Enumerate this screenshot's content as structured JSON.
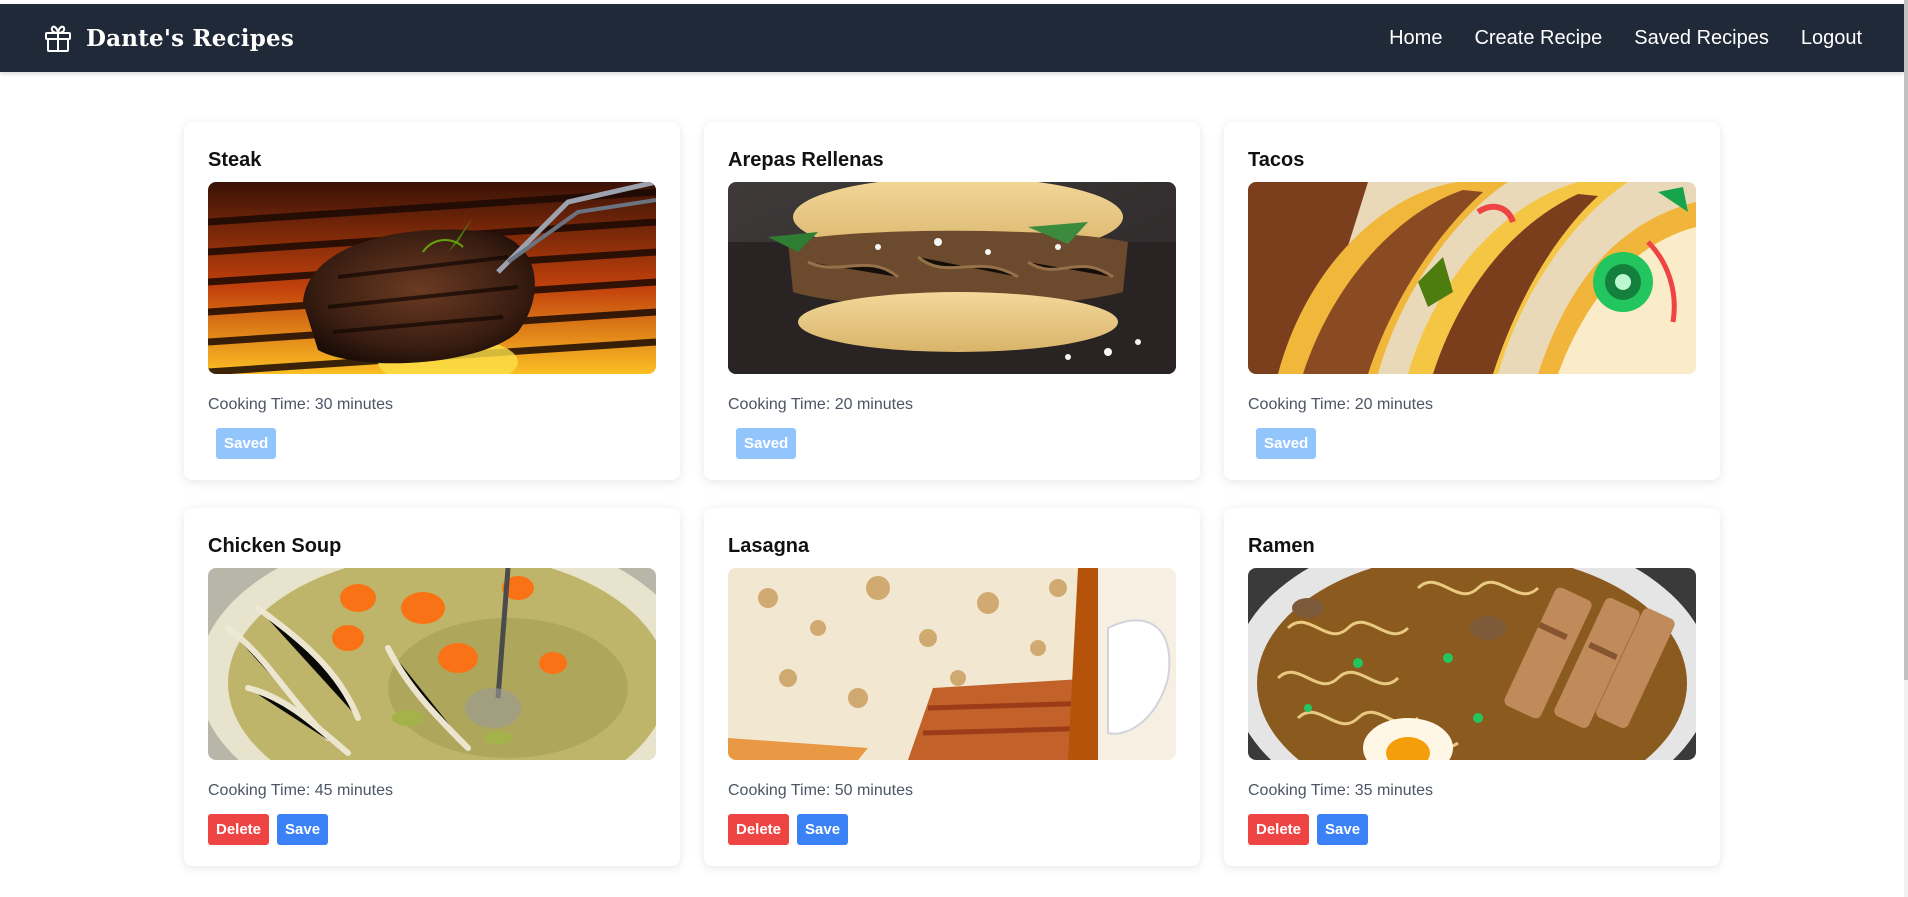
{
  "brand": {
    "title": "Dante's Recipes",
    "icon": "gift-icon"
  },
  "nav": {
    "home": "Home",
    "create": "Create Recipe",
    "saved": "Saved Recipes",
    "logout": "Logout"
  },
  "cook_prefix": "Cooking Time:",
  "recipes": [
    {
      "name": "Steak",
      "cooking_time": "Cooking Time: 30 minutes",
      "image": "steak-photo",
      "saved": true,
      "saved_label": "Saved"
    },
    {
      "name": "Arepas Rellenas",
      "cooking_time": "Cooking Time: 20 minutes",
      "image": "arepas-photo",
      "saved": true,
      "saved_label": "Saved"
    },
    {
      "name": "Tacos",
      "cooking_time": "Cooking Time: 20 minutes",
      "image": "tacos-photo",
      "saved": true,
      "saved_label": "Saved"
    },
    {
      "name": "Chicken Soup",
      "cooking_time": "Cooking Time: 45 minutes",
      "image": "chicken-soup-photo",
      "saved": false,
      "delete_label": "Delete",
      "save_label": "Save"
    },
    {
      "name": "Lasagna",
      "cooking_time": "Cooking Time: 50 minutes",
      "image": "lasagna-photo",
      "saved": false,
      "delete_label": "Delete",
      "save_label": "Save"
    },
    {
      "name": "Ramen",
      "cooking_time": "Cooking Time: 35 minutes",
      "image": "ramen-photo",
      "saved": false,
      "delete_label": "Delete",
      "save_label": "Save"
    }
  ],
  "colors": {
    "navbar": "#1f2937",
    "saved_button": "#93c5fd",
    "delete_button": "#ef4444",
    "save_button": "#3b82f6"
  }
}
